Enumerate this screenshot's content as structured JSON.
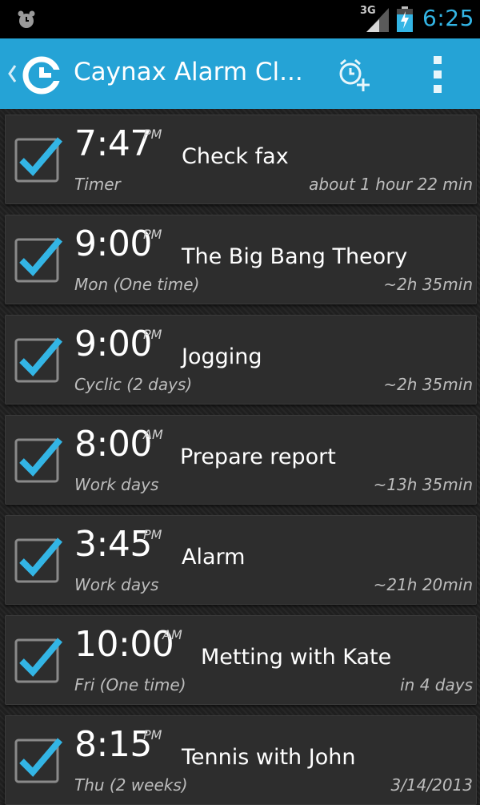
{
  "status_bar": {
    "network": "3G",
    "time": "6:25",
    "icons": [
      "alarm-icon",
      "signal-icon",
      "battery-charging-icon"
    ]
  },
  "action_bar": {
    "title": "Caynax Alarm Cl...",
    "icons": [
      "up-caret-icon",
      "caynax-logo-icon",
      "add-alarm-icon",
      "overflow-menu-icon"
    ]
  },
  "colors": {
    "accent": "#33b5e5",
    "action_bar": "#25a3d6",
    "card": "#2d2d2d"
  },
  "alarms": [
    {
      "time": "7:47",
      "ampm": "PM",
      "label": "Check fax",
      "schedule": "Timer",
      "remaining": "about 1 hour 22 min",
      "enabled": true
    },
    {
      "time": "9:00",
      "ampm": "PM",
      "label": "The Big Bang Theory",
      "schedule": "Mon (One time)",
      "remaining": "~2h 35min",
      "enabled": true
    },
    {
      "time": "9:00",
      "ampm": "PM",
      "label": "Jogging",
      "schedule": "Cyclic (2 days)",
      "remaining": "~2h 35min",
      "enabled": true
    },
    {
      "time": "8:00",
      "ampm": "AM",
      "label": "Prepare report",
      "schedule": "Work days",
      "remaining": "~13h 35min",
      "enabled": true
    },
    {
      "time": "3:45",
      "ampm": "PM",
      "label": "Alarm",
      "schedule": "Work days",
      "remaining": "~21h 20min",
      "enabled": true
    },
    {
      "time": "10:00",
      "ampm": "AM",
      "label": "Metting with Kate",
      "schedule": "Fri (One time)",
      "remaining": "in 4 days",
      "enabled": true
    },
    {
      "time": "8:15",
      "ampm": "PM",
      "label": "Tennis with John",
      "schedule": "Thu (2 weeks)",
      "remaining": "3/14/2013",
      "enabled": true
    }
  ]
}
